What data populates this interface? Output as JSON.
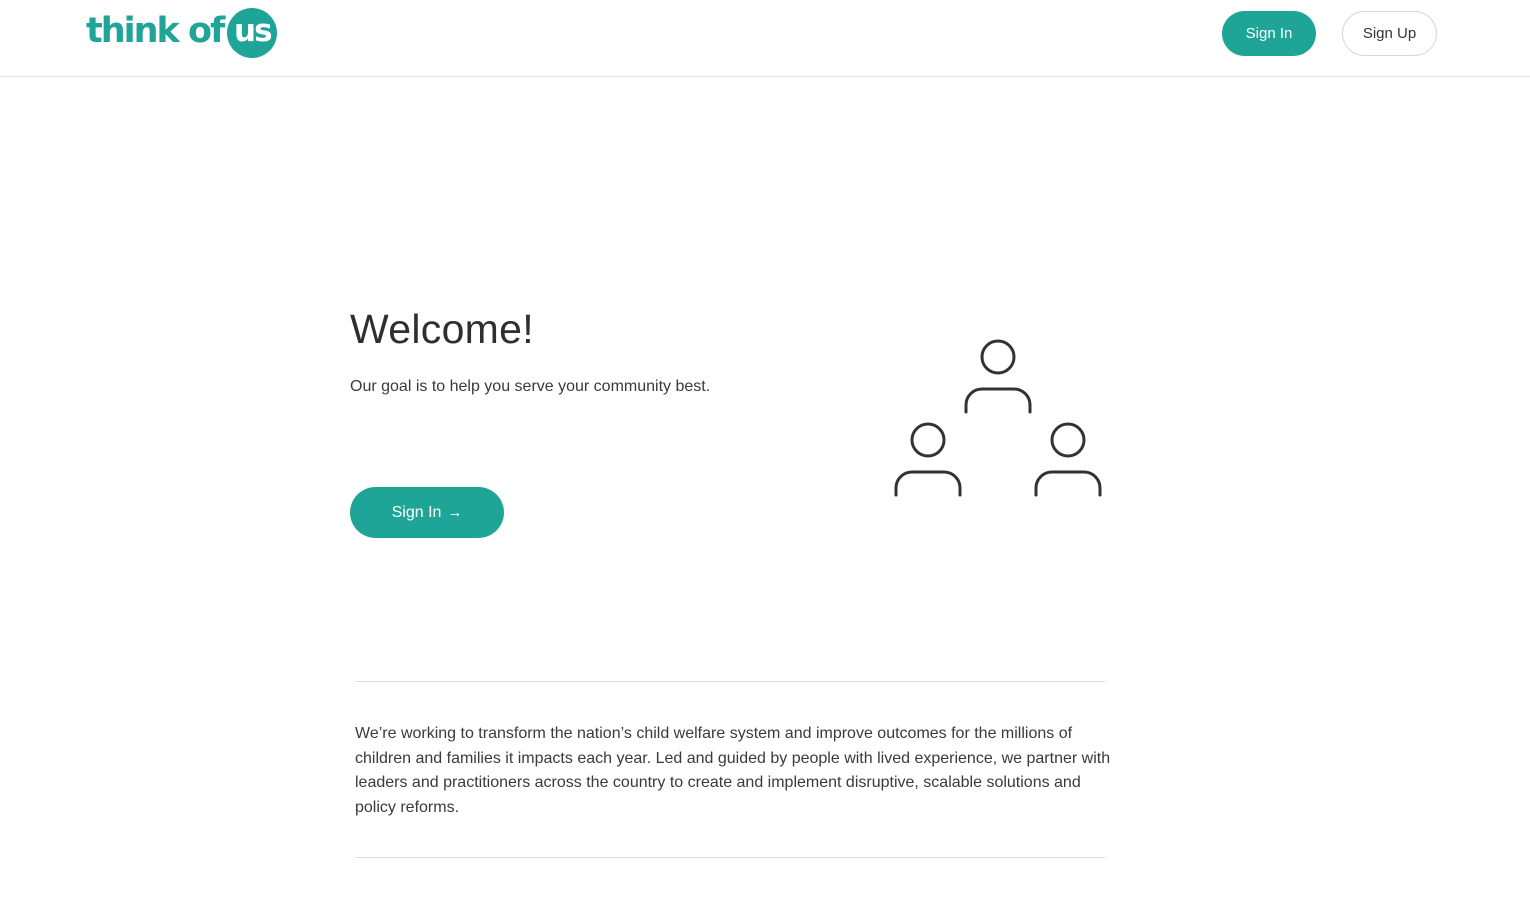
{
  "header": {
    "logo_text": "think of",
    "logo_circle_text": "us",
    "signin_label": "Sign In",
    "signup_label": "Sign Up"
  },
  "hero": {
    "title": "Welcome!",
    "subtitle": "Our goal is to help you serve your community best.",
    "cta_label": "Sign In",
    "cta_arrow": "→",
    "illustration_icon": "people-group-icon"
  },
  "about": {
    "text": "We’re working to transform the nation’s child welfare system and improve outcomes for the millions of children and families it impacts each year. Led and guided by people with lived experience, we partner with leaders and practitioners across the country to create and implement disruptive, scalable solutions and policy reforms."
  },
  "colors": {
    "brand": "#1fa597",
    "text": "#333333",
    "divider": "#dcdcdc"
  }
}
